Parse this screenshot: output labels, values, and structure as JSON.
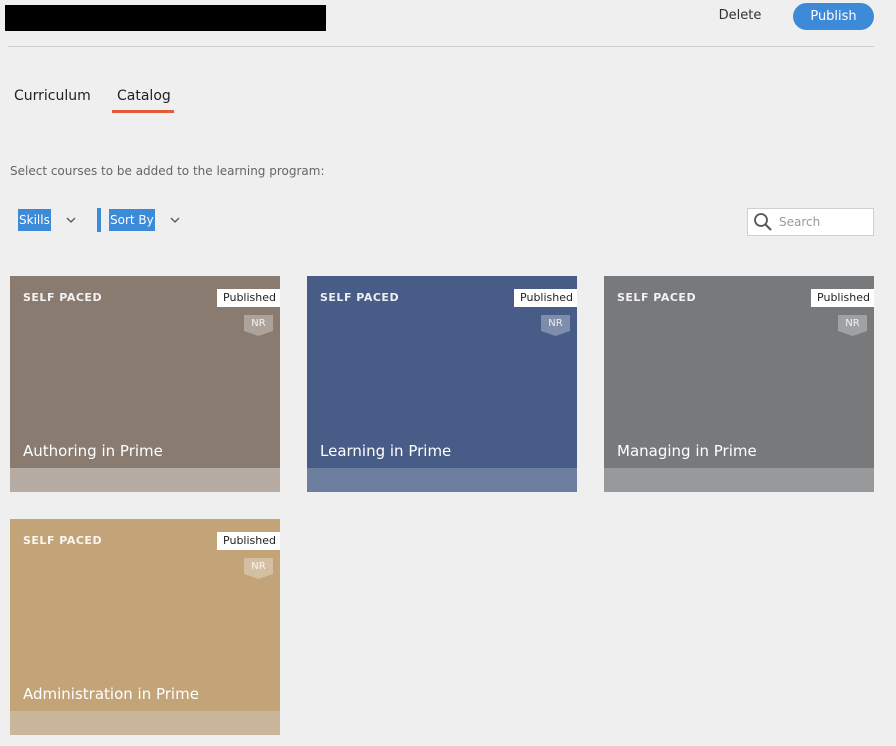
{
  "header": {
    "delete_label": "Delete",
    "publish_label": "Publish",
    "publish_color": "#3d8ad8"
  },
  "tabs": [
    {
      "label": "Curriculum",
      "active": false
    },
    {
      "label": "Catalog",
      "active": true
    }
  ],
  "tab_accent": "#e65a3a",
  "instruction": "Select courses to be added to the learning program:",
  "filters": {
    "skills_label": "Skills",
    "sort_label": "Sort By"
  },
  "search": {
    "placeholder": "Search",
    "value": ""
  },
  "courses": [
    {
      "type": "SELF PACED",
      "status": "Published",
      "badge": "NR",
      "title": "Authoring in Prime",
      "color": "#8a7b70",
      "footer_color": "#b6aca4"
    },
    {
      "type": "SELF PACED",
      "status": "Published",
      "badge": "NR",
      "title": "Learning in Prime",
      "color": "#475c86",
      "footer_color": "#6d7e9f"
    },
    {
      "type": "SELF PACED",
      "status": "Published",
      "badge": "NR",
      "title": "Managing in Prime",
      "color": "#78797b",
      "footer_color": "#98999b"
    },
    {
      "type": "SELF PACED",
      "status": "Published",
      "badge": "NR",
      "title": "Administration in Prime",
      "color": "#c2a478",
      "footer_color": "#c9b69b"
    }
  ]
}
